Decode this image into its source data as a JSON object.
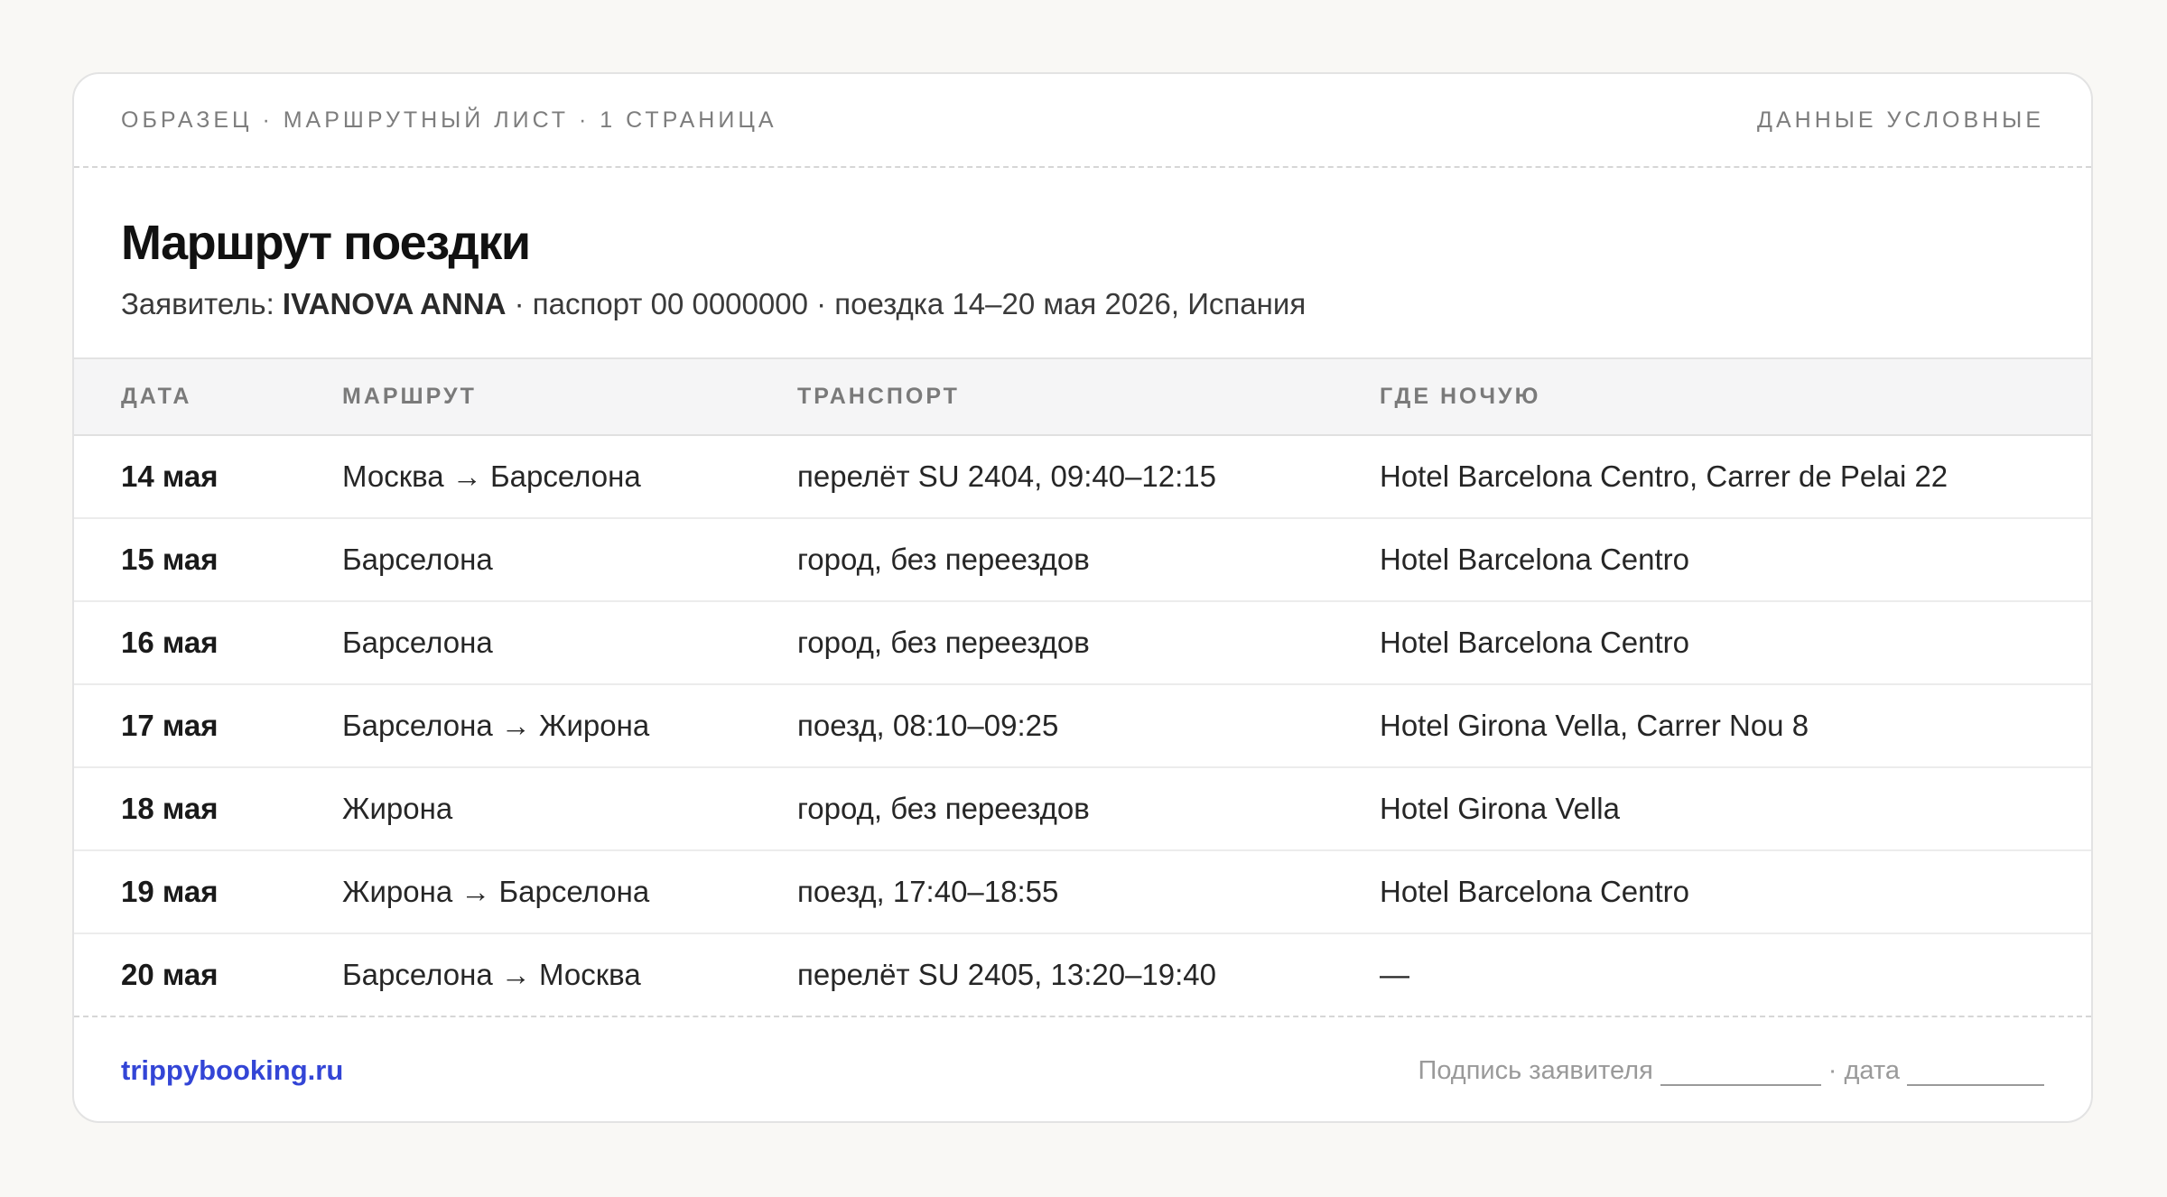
{
  "topbar": {
    "left": "ОБРАЗЕЦ · МАРШРУТНЫЙ ЛИСТ · 1 СТРАНИЦА",
    "right": "ДАННЫЕ УСЛОВНЫЕ"
  },
  "header": {
    "title": "Маршрут поездки",
    "applicant_label": "Заявитель: ",
    "applicant_name": "IVANOVA ANNA",
    "details": " · паспорт 00 0000000 · поездка 14–20 мая 2026, Испания"
  },
  "table": {
    "columns": [
      "ДАТА",
      "МАРШРУТ",
      "ТРАНСПОРТ",
      "ГДЕ НОЧУЮ"
    ],
    "rows": [
      {
        "date": "14 мая",
        "route": "Москва → Барселона",
        "transport": "перелёт SU 2404, 09:40–12:15",
        "stay": "Hotel Barcelona Centro, Carrer de Pelai 22"
      },
      {
        "date": "15 мая",
        "route": "Барселона",
        "transport": "город, без переездов",
        "stay": "Hotel Barcelona Centro"
      },
      {
        "date": "16 мая",
        "route": "Барселона",
        "transport": "город, без переездов",
        "stay": "Hotel Barcelona Centro"
      },
      {
        "date": "17 мая",
        "route": "Барселона → Жирона",
        "transport": "поезд, 08:10–09:25",
        "stay": "Hotel Girona Vella, Carrer Nou 8"
      },
      {
        "date": "18 мая",
        "route": "Жирона",
        "transport": "город, без переездов",
        "stay": "Hotel Girona Vella"
      },
      {
        "date": "19 мая",
        "route": "Жирона → Барселона",
        "transport": "поезд, 17:40–18:55",
        "stay": "Hotel Barcelona Centro"
      },
      {
        "date": "20 мая",
        "route": "Барселона → Москва",
        "transport": "перелёт SU 2405, 13:20–19:40",
        "stay": "—"
      }
    ]
  },
  "footer": {
    "site": "trippybooking.ru",
    "signature_label": "Подпись заявителя",
    "date_label": "· дата"
  },
  "colors": {
    "background": "#f9f8f5",
    "card": "#ffffff",
    "accent_link": "#3345d6",
    "muted_text": "#7d7d7d"
  }
}
